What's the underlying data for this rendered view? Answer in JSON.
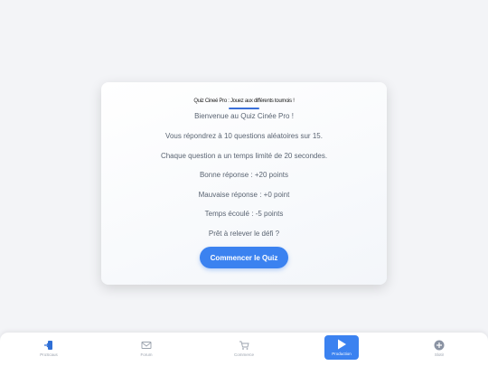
{
  "card": {
    "title": "Quiz Cineé Pro : Jouez aux différents tournois !",
    "lines": [
      "Bienvenue au Quiz Cinée Pro !",
      "Vous répondrez à 10 questions aléatoires sur 15.",
      "Chaque question a un temps limité de 20 secondes.",
      "Bonne réponse : +20 points",
      "Mauvaise réponse : +0 point",
      "Temps écoulé : -5 points",
      "Prêt à relever le défi ?"
    ],
    "start_label": "Commencer le Quiz"
  },
  "nav": {
    "items": [
      {
        "label": "ProScaus",
        "icon": "login-icon"
      },
      {
        "label": "Forum",
        "icon": "mail-icon"
      },
      {
        "label": "Commerce",
        "icon": "cart-icon"
      },
      {
        "label": "Production",
        "icon": "play-icon"
      },
      {
        "label": "Slotir",
        "icon": "plus-circle-icon"
      }
    ]
  },
  "colors": {
    "accent": "#3b82f0",
    "text_muted": "#5a6472",
    "nav_label": "#9aa2ad",
    "login_icon": "#2f6fd6"
  }
}
